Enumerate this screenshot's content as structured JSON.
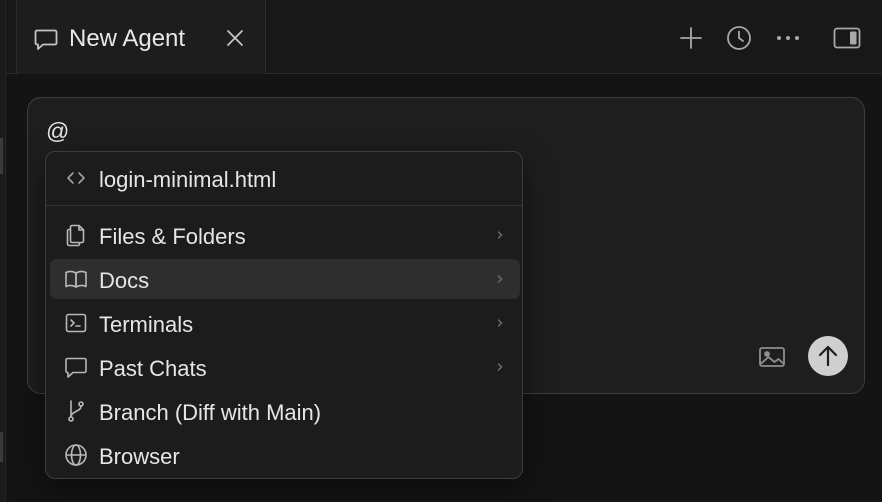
{
  "tab": {
    "icon": "chat-bubble-icon",
    "title": "New Agent",
    "close_icon": "close-icon"
  },
  "toolbar": {
    "icons": [
      "plus-icon",
      "history-icon",
      "more-icon",
      "sidebar-toggle-icon"
    ]
  },
  "composer": {
    "input_text": "@",
    "image_icon": "image-icon",
    "send_icon": "arrow-up-icon"
  },
  "mention_menu": {
    "recent_file": {
      "icon": "code-icon",
      "label": "login-minimal.html"
    },
    "items": [
      {
        "icon": "files-icon",
        "label": "Files & Folders",
        "has_submenu": true
      },
      {
        "icon": "book-icon",
        "label": "Docs",
        "has_submenu": true,
        "active": true
      },
      {
        "icon": "terminal-icon",
        "label": "Terminals",
        "has_submenu": true
      },
      {
        "icon": "chat-bubble-icon",
        "label": "Past Chats",
        "has_submenu": true
      },
      {
        "icon": "branch-icon",
        "label": "Branch (Diff with Main)",
        "has_submenu": false
      },
      {
        "icon": "globe-icon",
        "label": "Browser",
        "has_submenu": false
      }
    ]
  },
  "colors": {
    "background": "#141414",
    "panel": "#1e1e1e",
    "text": "#e6e6e6",
    "icon": "#b8b8b8",
    "active_item": "#2e2e2e",
    "send_button": "#cfcfcf"
  }
}
